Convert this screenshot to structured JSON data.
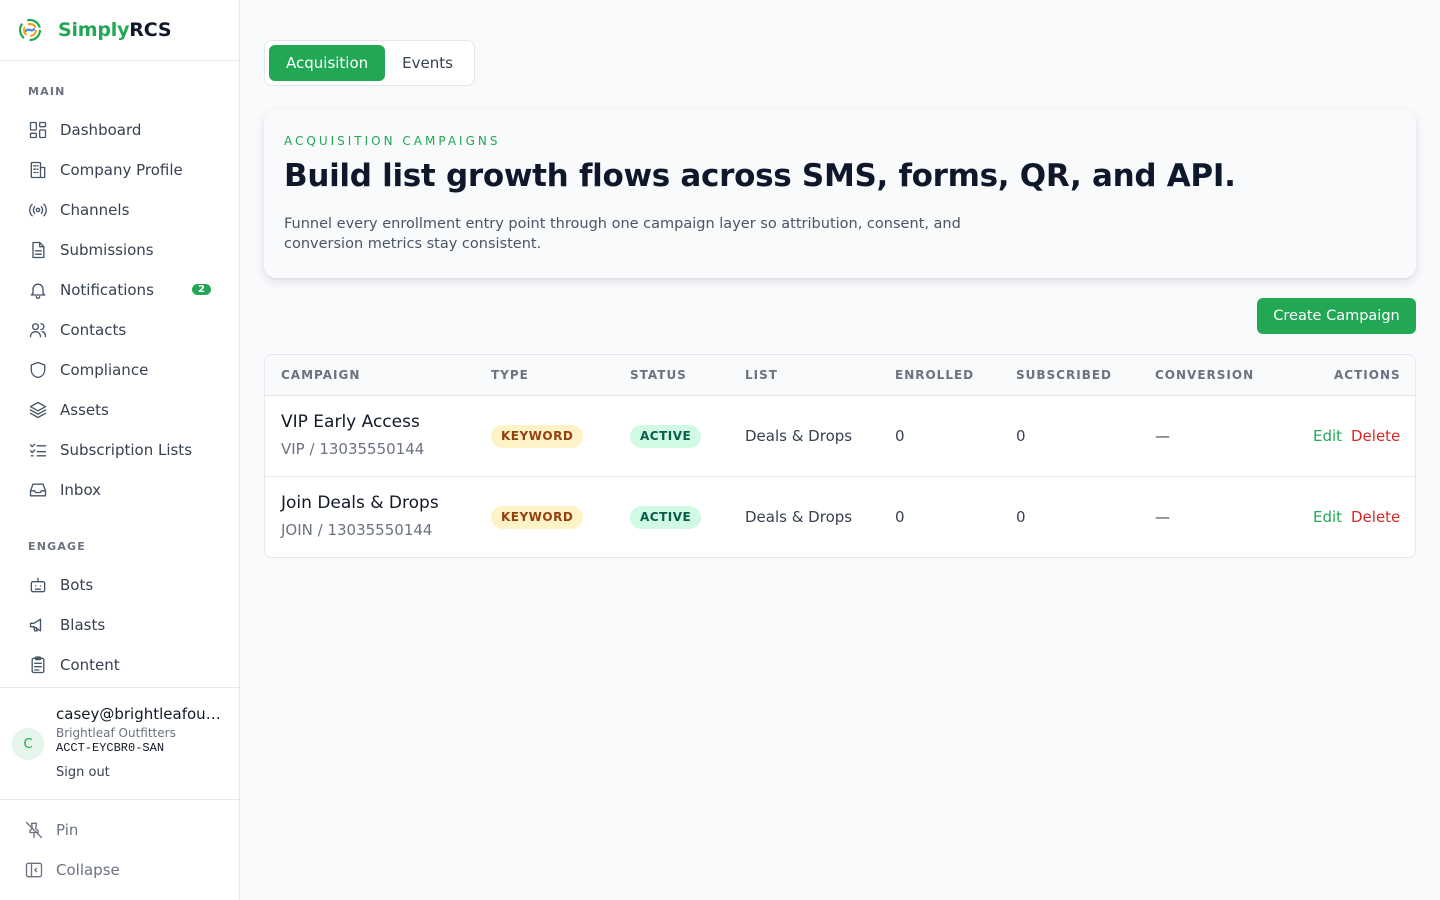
{
  "brand": {
    "name_a": "Simply",
    "name_b": "RCS"
  },
  "sidebar": {
    "main_label": "MAIN",
    "engage_label": "ENGAGE",
    "main_items": [
      {
        "label": "Dashboard",
        "icon": "dashboard-icon"
      },
      {
        "label": "Company Profile",
        "icon": "building-icon"
      },
      {
        "label": "Channels",
        "icon": "broadcast-icon"
      },
      {
        "label": "Submissions",
        "icon": "document-icon"
      },
      {
        "label": "Notifications",
        "icon": "bell-icon",
        "badge": "2"
      },
      {
        "label": "Contacts",
        "icon": "users-icon"
      },
      {
        "label": "Compliance",
        "icon": "shield-icon"
      },
      {
        "label": "Assets",
        "icon": "layers-icon"
      },
      {
        "label": "Subscription Lists",
        "icon": "checklist-icon"
      },
      {
        "label": "Inbox",
        "icon": "inbox-icon"
      }
    ],
    "engage_items": [
      {
        "label": "Bots",
        "icon": "bot-icon"
      },
      {
        "label": "Blasts",
        "icon": "megaphone-icon"
      },
      {
        "label": "Content",
        "icon": "clipboard-icon"
      }
    ]
  },
  "account": {
    "initial": "C",
    "email": "casey@brightleafoutfitters.com",
    "company": "Brightleaf Outfitters",
    "id": "ACCT-EYCBR0-SAN",
    "signout": "Sign out"
  },
  "footer": {
    "pin": "Pin",
    "collapse": "Collapse"
  },
  "tabs": [
    {
      "label": "Acquisition",
      "active": true
    },
    {
      "label": "Events",
      "active": false
    }
  ],
  "hero": {
    "eyebrow": "ACQUISITION CAMPAIGNS",
    "title": "Build list growth flows across SMS, forms, QR, and API.",
    "description": "Funnel every enrollment entry point through one campaign layer so attribution, consent, and conversion metrics stay consistent."
  },
  "create_button": "Create Campaign",
  "table": {
    "headers": {
      "campaign": "CAMPAIGN",
      "type": "TYPE",
      "status": "STATUS",
      "list": "LIST",
      "enrolled": "ENROLLED",
      "subscribed": "SUBSCRIBED",
      "conversion": "CONVERSION",
      "actions": "ACTIONS"
    },
    "rows": [
      {
        "name": "VIP Early Access",
        "sub": "VIP / 13035550144",
        "type": "KEYWORD",
        "status": "ACTIVE",
        "list": "Deals & Drops",
        "enrolled": "0",
        "subscribed": "0",
        "conversion": "—",
        "edit": "Edit",
        "delete": "Delete"
      },
      {
        "name": "Join Deals & Drops",
        "sub": "JOIN / 13035550144",
        "type": "KEYWORD",
        "status": "ACTIVE",
        "list": "Deals & Drops",
        "enrolled": "0",
        "subscribed": "0",
        "conversion": "—",
        "edit": "Edit",
        "delete": "Delete"
      }
    ]
  },
  "colors": {
    "accent": "#22a855",
    "danger": "#dc2626",
    "badge_type_bg": "#fef3c7",
    "badge_status_bg": "#d1fae5"
  }
}
